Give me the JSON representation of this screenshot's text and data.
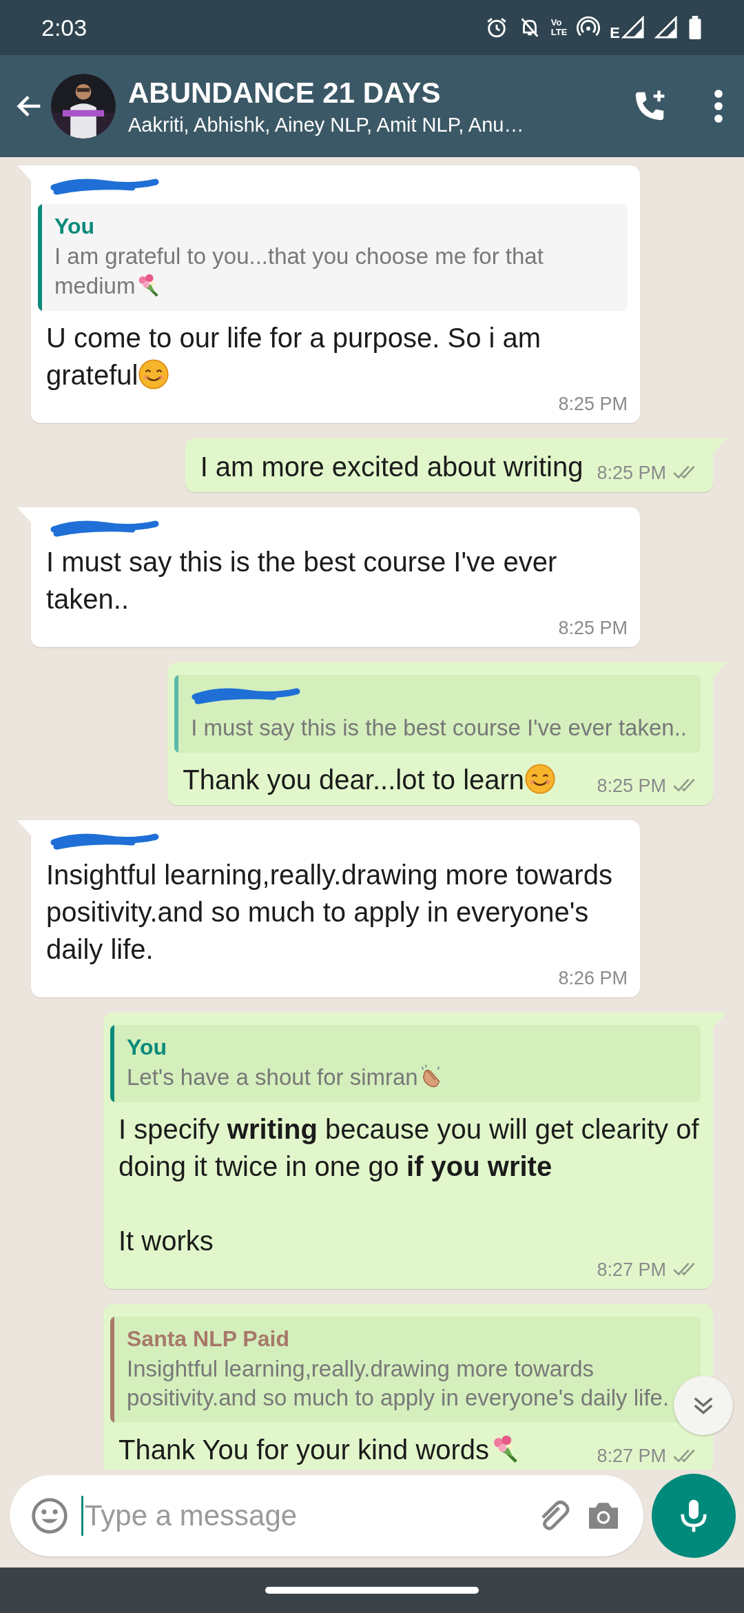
{
  "status_bar": {
    "time": "2:03",
    "volte_top": "Vo",
    "volte_bottom": "LTE",
    "network": "E"
  },
  "header": {
    "title": "ABUNDANCE 21 DAYS",
    "members": "Aakriti, Abhishk, Ainey NLP, Amit NLP, Anu…"
  },
  "messages": [
    {
      "kind": "incoming",
      "tail": true,
      "sender_redacted": true,
      "quote": {
        "author": "You",
        "author_redacted": false,
        "color": "#0a8a7a",
        "text": "I am grateful to you...that you choose me for that medium",
        "emoji": {
          "kind": "bouquet"
        }
      },
      "text": "U come to our life for a purpose. So i am grateful",
      "emoji": {
        "kind": "smile"
      },
      "time": "8:25 PM"
    },
    {
      "kind": "outgoing",
      "tail": true,
      "text": "I am more excited about writing",
      "time": "8:25 PM",
      "read": false
    },
    {
      "kind": "incoming",
      "tail": true,
      "sender_redacted": true,
      "text": "I must say this is the best course I've ever taken..",
      "time": "8:25 PM"
    },
    {
      "kind": "outgoing",
      "tail": true,
      "quote": {
        "author_redacted": true,
        "color": "#5bb8a8",
        "text": "I must say this is the best course I've ever taken.."
      },
      "text": "Thank you dear...lot to learn",
      "emoji": {
        "kind": "smile"
      },
      "time": "8:25 PM",
      "read": false
    },
    {
      "kind": "incoming",
      "tail": true,
      "sender_redacted": true,
      "text": "Insightful learning,really.drawing more towards positivity.and so much to apply in everyone's daily life.",
      "time": "8:26 PM"
    },
    {
      "kind": "outgoing",
      "tail": true,
      "quote": {
        "author": "You",
        "author_redacted": false,
        "color": "#0a8a7a",
        "text": "Let's have a shout for simran",
        "emoji": {
          "kind": "clap"
        }
      },
      "text": "I specify **writing** because you will get clearity of doing it twice in one go **if you write**\n\nIt works",
      "time": "8:27 PM",
      "read": false
    },
    {
      "kind": "outgoing",
      "tail": false,
      "quote": {
        "author": "Santa NLP Paid",
        "author_redacted": false,
        "color": "#a8796a",
        "text": "Insightful learning,really.drawing more towards positivity.and so much to apply in everyone's daily life."
      },
      "text": "Thank You for your kind words",
      "emoji": {
        "kind": "bouquet"
      },
      "time": "8:27 PM",
      "read": false
    }
  ],
  "composer": {
    "placeholder": "Type a message"
  }
}
